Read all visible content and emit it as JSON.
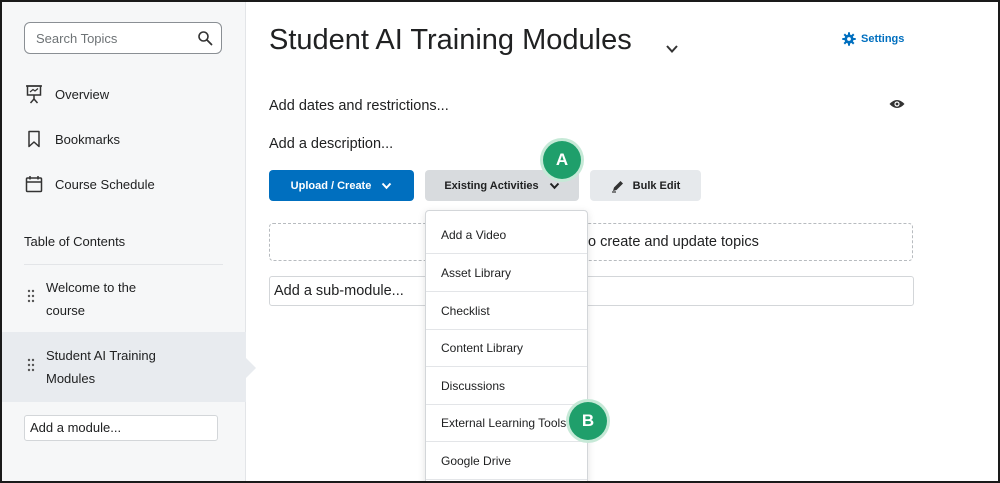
{
  "sidebar": {
    "search": {
      "placeholder": "Search Topics"
    },
    "nav": [
      {
        "label": "Overview",
        "icon": "presentation-icon"
      },
      {
        "label": "Bookmarks",
        "icon": "bookmark-icon"
      },
      {
        "label": "Course Schedule",
        "icon": "calendar-icon"
      }
    ],
    "toc_title": "Table of Contents",
    "modules": [
      {
        "line1": "Welcome to the",
        "line2": "course",
        "active": false
      },
      {
        "line1": "Student AI Training",
        "line2": "Modules",
        "active": true
      }
    ],
    "add_module": "Add a module..."
  },
  "main": {
    "title": "Student AI Training Modules",
    "settings_label": "Settings",
    "add_dates": "Add dates and restrictions...",
    "add_description": "Add a description...",
    "buttons": {
      "upload_create": "Upload / Create",
      "existing_activities": "Existing Activities",
      "bulk_edit": "Bulk Edit"
    },
    "dropzone_text": "o create and update topics",
    "add_submodule": "Add a sub-module...",
    "dropdown_items": [
      "Add a Video",
      "Asset Library",
      "Checklist",
      "Content Library",
      "Discussions",
      "External Learning Tools",
      "Google Drive"
    ]
  },
  "callouts": {
    "a": "A",
    "b": "B"
  },
  "colors": {
    "accent": "#006fbf",
    "callout": "#1f9f6b",
    "sidebar_bg": "#f6f7f8"
  }
}
